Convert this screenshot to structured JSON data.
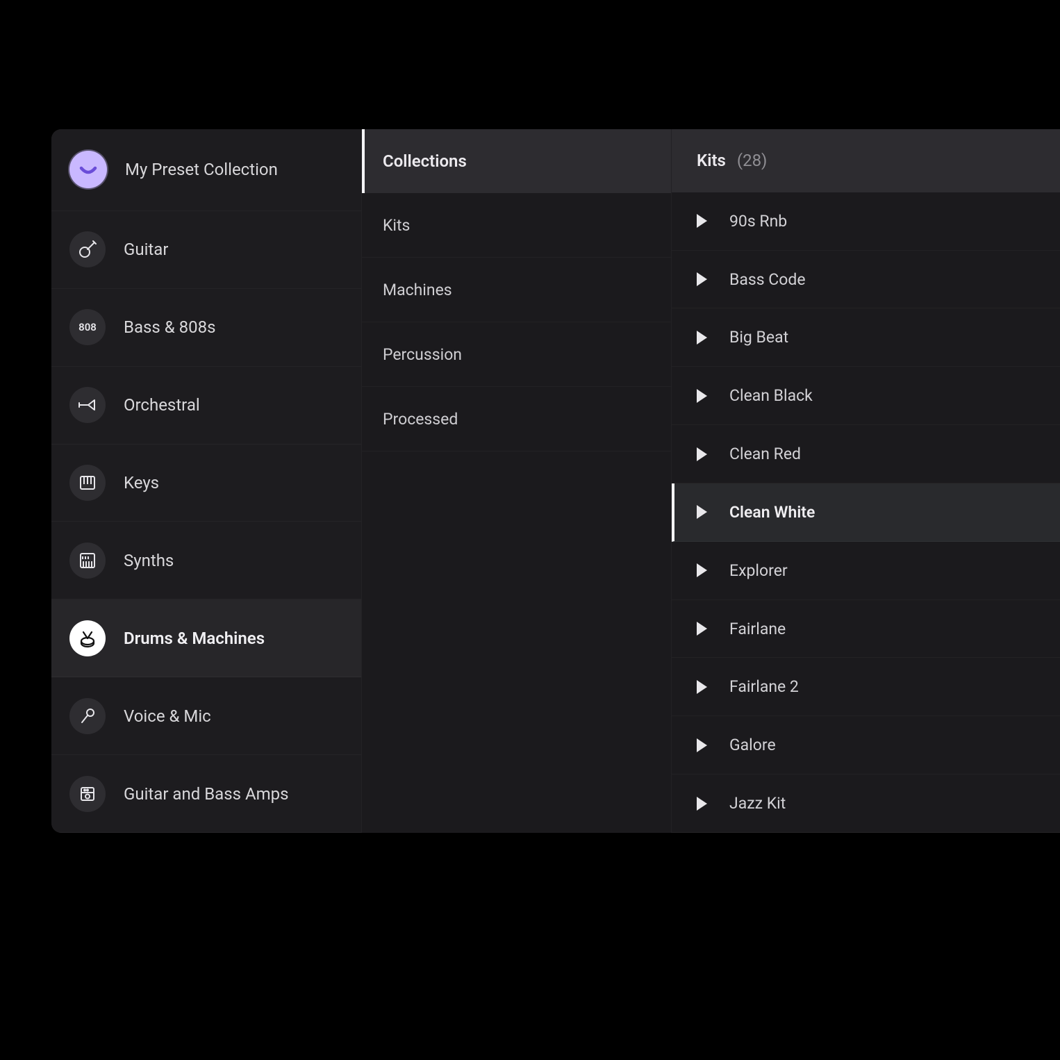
{
  "sidebar": {
    "preset_label": "My Preset Collection",
    "items": [
      {
        "label": "Guitar",
        "icon": "guitar"
      },
      {
        "label": "Bass & 808s",
        "icon": "808"
      },
      {
        "label": "Orchestral",
        "icon": "horn"
      },
      {
        "label": "Keys",
        "icon": "keys"
      },
      {
        "label": "Synths",
        "icon": "synth"
      },
      {
        "label": "Drums & Machines",
        "icon": "drum",
        "selected": true
      },
      {
        "label": "Voice & Mic",
        "icon": "mic"
      },
      {
        "label": "Guitar and Bass Amps",
        "icon": "amp"
      }
    ]
  },
  "collections": {
    "header": "Collections",
    "items": [
      {
        "label": "Kits",
        "selected": true
      },
      {
        "label": "Machines"
      },
      {
        "label": "Percussion"
      },
      {
        "label": "Processed"
      }
    ]
  },
  "kits": {
    "title": "Kits",
    "count": "(28)",
    "items": [
      {
        "label": "90s Rnb"
      },
      {
        "label": "Bass Code"
      },
      {
        "label": "Big Beat"
      },
      {
        "label": "Clean Black"
      },
      {
        "label": "Clean Red"
      },
      {
        "label": "Clean White",
        "selected": true
      },
      {
        "label": "Explorer"
      },
      {
        "label": "Fairlane"
      },
      {
        "label": "Fairlane 2"
      },
      {
        "label": "Galore"
      },
      {
        "label": "Jazz Kit"
      }
    ]
  }
}
